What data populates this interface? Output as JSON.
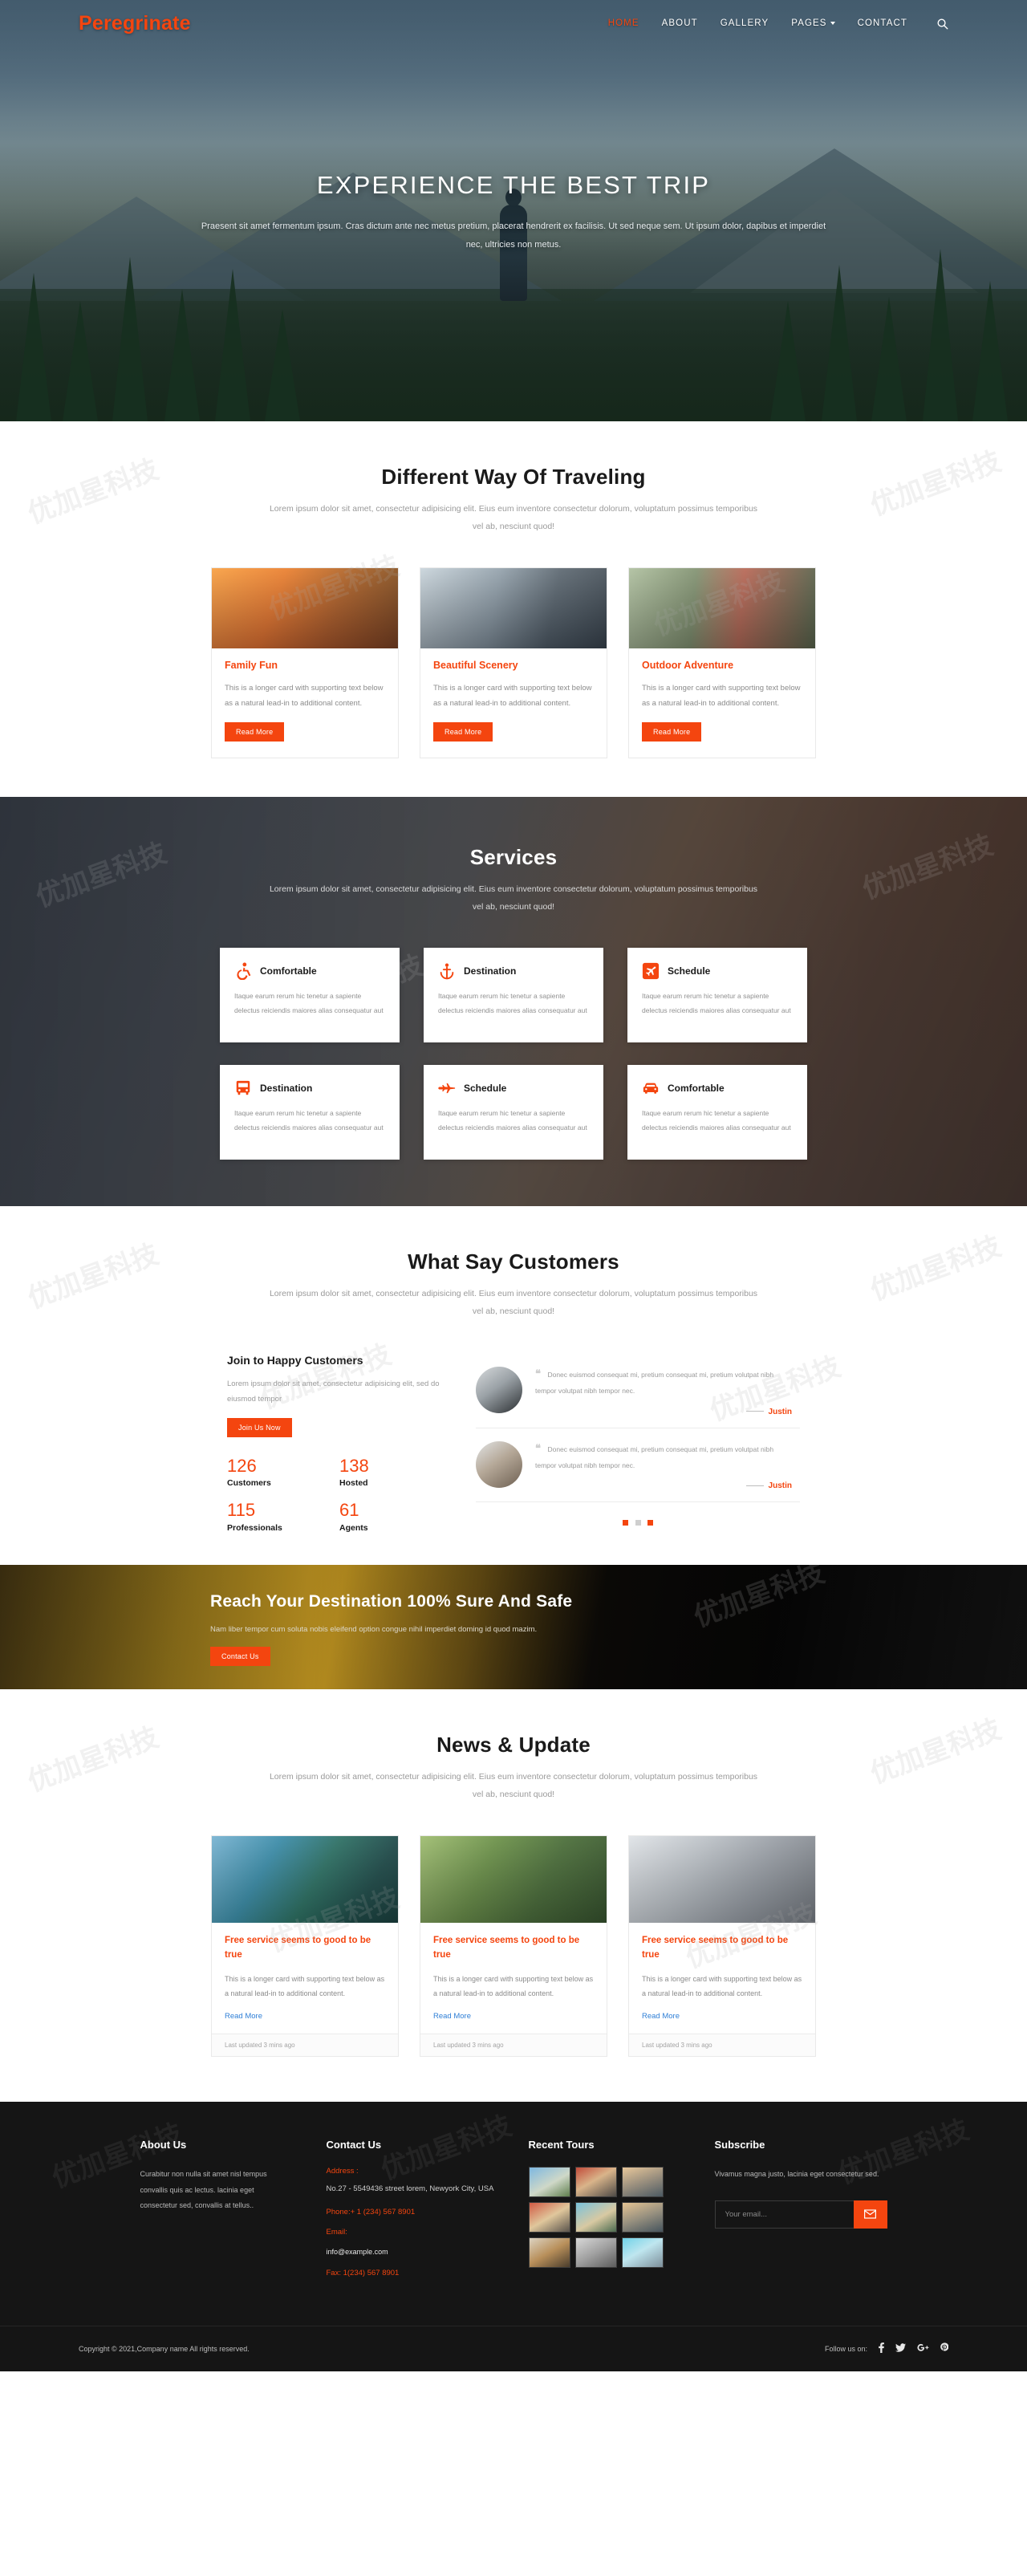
{
  "brand": "Peregrinate",
  "nav": {
    "items": [
      {
        "label": "HOME",
        "active": true
      },
      {
        "label": "ABOUT",
        "active": false
      },
      {
        "label": "GALLERY",
        "active": false
      },
      {
        "label": "PAGES",
        "active": false,
        "dropdown": true
      },
      {
        "label": "CONTACT",
        "active": false
      }
    ],
    "search_icon": "search-icon"
  },
  "hero": {
    "title": "EXPERIENCE THE BEST TRIP",
    "subtitle": "Praesent sit amet fermentum ipsum. Cras dictum ante nec metus pretium, placerat hendrerit ex facilisis. Ut sed neque sem. Ut ipsum dolor, dapibus et imperdiet nec, ultricies non metus."
  },
  "traveling": {
    "title": "Different Way Of Traveling",
    "subtitle": "Lorem ipsum dolor sit amet, consectetur adipisicing elit. Eius eum inventore consectetur dolorum, voluptatum possimus temporibus vel ab, nesciunt quod!",
    "cards": [
      {
        "title": "Family Fun",
        "text": "This is a longer card with supporting text below as a natural lead-in to additional content.",
        "button": "Read More"
      },
      {
        "title": "Beautiful Scenery",
        "text": "This is a longer card with supporting text below as a natural lead-in to additional content.",
        "button": "Read More"
      },
      {
        "title": "Outdoor Adventure",
        "text": "This is a longer card with supporting text below as a natural lead-in to additional content.",
        "button": "Read More"
      }
    ]
  },
  "services": {
    "title": "Services",
    "subtitle": "Lorem ipsum dolor sit amet, consectetur adipisicing elit. Eius eum inventore consectetur dolorum, voluptatum possimus temporibus vel ab, nesciunt quod!",
    "items": [
      {
        "title": "Comfortable",
        "text": "Itaque earum rerum hic tenetur a sapiente delectus reiciendis maiores alias consequatur aut",
        "icon": "wheelchair-icon"
      },
      {
        "title": "Destination",
        "text": "Itaque earum rerum hic tenetur a sapiente delectus reiciendis maiores alias consequatur aut",
        "icon": "anchor-icon"
      },
      {
        "title": "Schedule",
        "text": "Itaque earum rerum hic tenetur a sapiente delectus reiciendis maiores alias consequatur aut",
        "icon": "plane-square-icon"
      },
      {
        "title": "Destination",
        "text": "Itaque earum rerum hic tenetur a sapiente delectus reiciendis maiores alias consequatur aut",
        "icon": "bus-icon"
      },
      {
        "title": "Schedule",
        "text": "Itaque earum rerum hic tenetur a sapiente delectus reiciendis maiores alias consequatur aut",
        "icon": "fighter-jet-icon"
      },
      {
        "title": "Comfortable",
        "text": "Itaque earum rerum hic tenetur a sapiente delectus reiciendis maiores alias consequatur aut",
        "icon": "car-icon"
      }
    ]
  },
  "customers": {
    "title": "What Say Customers",
    "subtitle": "Lorem ipsum dolor sit amet, consectetur adipisicing elit. Eius eum inventore consectetur dolorum, voluptatum possimus temporibus vel ab, nesciunt quod!",
    "join_title": "Join to Happy Customers",
    "join_text": "Lorem ipsum dolor sit amet, consectetur adipisicing elit, sed do eiusmod tempor",
    "join_button": "Join Us Now",
    "stats": [
      {
        "number": "126",
        "label": "Customers"
      },
      {
        "number": "138",
        "label": "Hosted"
      },
      {
        "number": "115",
        "label": "Professionals"
      },
      {
        "number": "61",
        "label": "Agents"
      }
    ],
    "testimonials": [
      {
        "quote": "Donec euismod consequat mi, pretium consequat mi, pretium volutpat nibh tempor volutpat nibh tempor nec.",
        "author": "Justin"
      },
      {
        "quote": "Donec euismod consequat mi, pretium consequat mi, pretium volutpat nibh tempor volutpat nibh tempor nec.",
        "author": "Justin"
      }
    ],
    "dots": 3,
    "active_dot": 1
  },
  "cta": {
    "title": "Reach Your Destination 100% Sure And Safe",
    "text": "Nam liber tempor cum soluta nobis eleifend option congue nihil imperdiet doming id quod mazim.",
    "button": "Contact Us"
  },
  "news": {
    "title": "News & Update",
    "subtitle": "Lorem ipsum dolor sit amet, consectetur adipisicing elit. Eius eum inventore consectetur dolorum, voluptatum possimus temporibus vel ab, nesciunt quod!",
    "cards": [
      {
        "title": "Free service seems to good to be true",
        "text": "This is a longer card with supporting text below as a natural lead-in to additional content.",
        "link": "Read More",
        "updated": "Last updated 3 mins ago"
      },
      {
        "title": "Free service seems to good to be true",
        "text": "This is a longer card with supporting text below as a natural lead-in to additional content.",
        "link": "Read More",
        "updated": "Last updated 3 mins ago"
      },
      {
        "title": "Free service seems to good to be true",
        "text": "This is a longer card with supporting text below as a natural lead-in to additional content.",
        "link": "Read More",
        "updated": "Last updated 3 mins ago"
      }
    ]
  },
  "footer": {
    "about": {
      "title": "About Us",
      "text": "Curabitur non nulla sit amet nisl tempus convallis quis ac lectus. lacinia eget consectetur sed, convallis at tellus.."
    },
    "contact": {
      "title": "Contact Us",
      "address_label": "Address :",
      "address_value": "No.27 - 5549436 street lorem, Newyork City, USA",
      "phone": "Phone:+ 1 (234) 567 8901",
      "email_label": "Email:",
      "email_value": "info@example.com",
      "fax": "Fax: 1(234) 567 8901"
    },
    "tours": {
      "title": "Recent Tours",
      "count": 9
    },
    "subscribe": {
      "title": "Subscribe",
      "text": "Vivamus magna justo, lacinia eget consectetur sed.",
      "placeholder": "Your email...",
      "button_icon": "envelope-icon"
    },
    "copyright": "Copyright © 2021,Company name All rights reserved.",
    "follow_label": "Follow us on:",
    "socials": [
      "facebook-icon",
      "twitter-icon",
      "google-plus-icon",
      "pinterest-icon"
    ]
  },
  "colors": {
    "accent": "#f4450f",
    "dark": "#151515",
    "link": "#2f7fd6"
  }
}
